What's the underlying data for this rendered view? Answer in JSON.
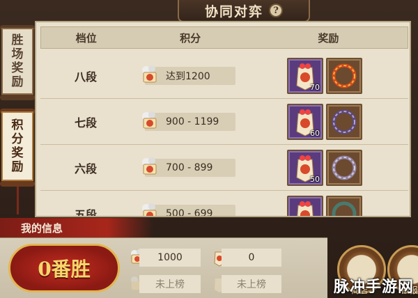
{
  "title": "协同对弈",
  "help_label": "?",
  "tabs": [
    {
      "chars": [
        "胜",
        "场",
        "奖",
        "励"
      ]
    },
    {
      "chars": [
        "积",
        "分",
        "奖",
        "励"
      ]
    }
  ],
  "table": {
    "headers": {
      "rank": "档位",
      "score": "积分",
      "reward": "奖励"
    },
    "rows": [
      {
        "rank": "八段",
        "score": "达到1200",
        "reward_count": "70"
      },
      {
        "rank": "七段",
        "score": "900 - 1199",
        "reward_count": "60"
      },
      {
        "rank": "六段",
        "score": "700 - 899",
        "reward_count": "50"
      },
      {
        "rank": "五段",
        "score": "500 - 699",
        "reward_count": ""
      }
    ]
  },
  "my_info": {
    "label": "我的信息",
    "wins": "0番胜",
    "score": "1000",
    "count": "0",
    "rank_status_1": "未上榜",
    "rank_status_2": "未上榜"
  },
  "side_buttons": [
    "商店",
    "战报"
  ],
  "watermark": "脉冲手游网",
  "colors": {
    "accent_red": "#a8261b",
    "purple_frame": "#5a3c7e",
    "paper": "#e9e1cd"
  }
}
